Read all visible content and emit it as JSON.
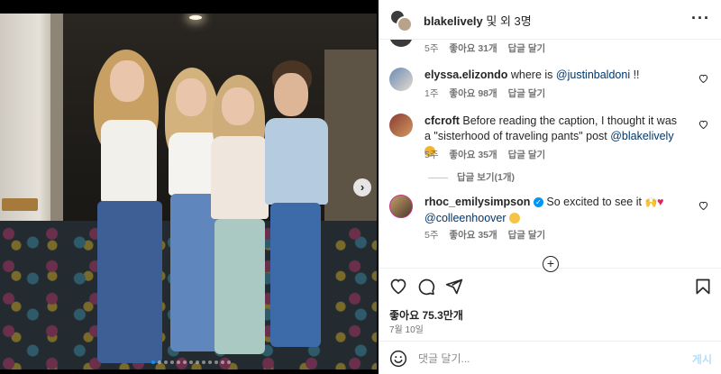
{
  "header": {
    "username": "blakelively",
    "collab_suffix": " 및 외 3명",
    "more_icon": "more-horizontal-icon"
  },
  "comments": [
    {
      "id": "partial",
      "time": "5주",
      "likes": "좋아요 31개",
      "reply": "답글 달기"
    },
    {
      "id": "elyssa",
      "username": "elyssa.elizondo",
      "text_before": " where is ",
      "mention": "@justinbaldoni",
      "text_after": " !!",
      "time": "1주",
      "likes": "좋아요 98개",
      "reply": "답글 달기"
    },
    {
      "id": "cfcroft",
      "username": "cfcroft",
      "text_before": " Before reading the caption, I thought it was a \"sisterhood of traveling pants\" post ",
      "mention": "@blakelively",
      "text_after": " ",
      "time": "5주",
      "likes": "좋아요 35개",
      "reply": "답글 달기",
      "view_replies": "답글 보기(1개)"
    },
    {
      "id": "rhoc",
      "username": "rhoc_emilysimpson",
      "text_before": " So excited to see it ",
      "mention": "@colleenhoover",
      "text_after": " ",
      "time": "5주",
      "likes": "좋아요 35개",
      "reply": "답글 달기"
    }
  ],
  "actions": {
    "likes": "좋아요 75.3만개",
    "date": "7월 10일",
    "comment_placeholder": "댓글 달기...",
    "post_label": "게시"
  },
  "carousel": {
    "count": 13,
    "active_index": 0
  },
  "colors": {
    "link": "#00376b",
    "accent": "#0095f6",
    "muted": "#737373"
  }
}
